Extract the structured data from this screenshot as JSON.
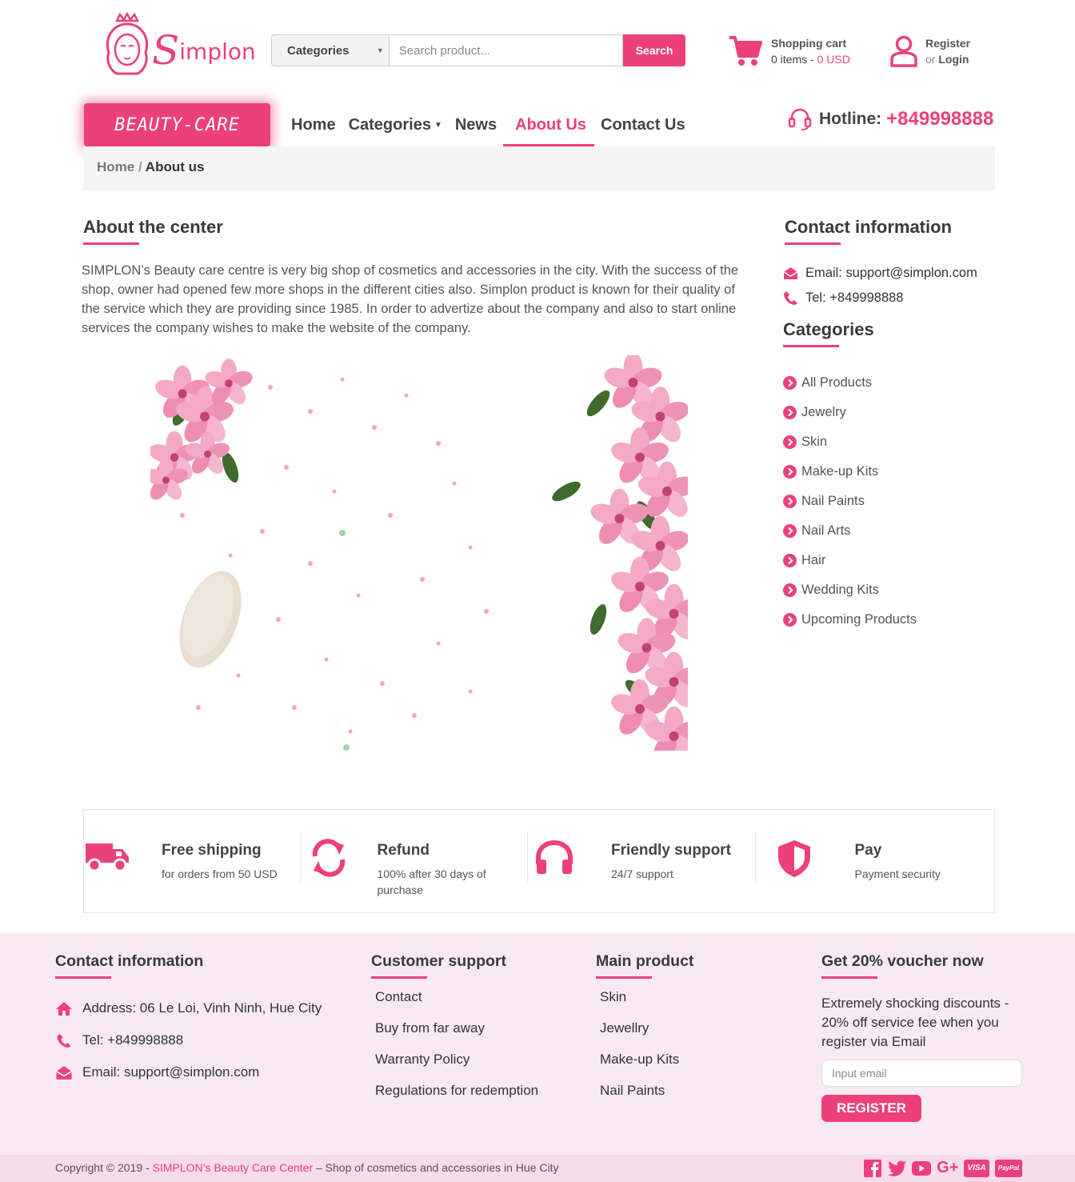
{
  "header": {
    "brand": "Simplon",
    "brand_initial": "S",
    "brand_rest": "implon",
    "search": {
      "category_label": "Categories",
      "placeholder": "Search product...",
      "button": "Search"
    },
    "cart": {
      "title": "Shopping cart",
      "items": "0 items - ",
      "total": "0 USD"
    },
    "account": {
      "register": "Register",
      "or": "or",
      "login": "Login"
    }
  },
  "nav": {
    "badge": "BEAUTY-CARE",
    "items": [
      "Home",
      "Categories",
      "News",
      "About Us",
      "Contact Us"
    ],
    "active": "About Us",
    "hotline_label": "Hotline:",
    "hotline_number": "+849998888"
  },
  "breadcrumb": {
    "home": "Home",
    "separator": "/",
    "current": "About us"
  },
  "about": {
    "title": "About the center",
    "text": "SIMPLON’s Beauty care centre is very big shop of cosmetics and accessories in the city. With the success of the shop, owner had opened few more shops in the different cities also. Simplon product is known for their quality of the service which they are providing since 1985. In order to advertize about the company and also to start online services the company wishes to make the website of the company."
  },
  "sidebar": {
    "contact_title": "Contact information",
    "email": "Email: support@simplon.com",
    "tel": "Tel: +849998888",
    "categories_title": "Categories",
    "categories": [
      "All Products",
      "Jewelry",
      "Skin",
      "Make-up Kits",
      "Nail Paints",
      "Nail Arts",
      "Hair",
      "Wedding Kits",
      "Upcoming Products"
    ]
  },
  "features": [
    {
      "icon": "truck-icon",
      "title": "Free shipping",
      "sub": "for orders from 50 USD"
    },
    {
      "icon": "refund-icon",
      "title": "Refund",
      "sub": "100% after 30 days of purchase"
    },
    {
      "icon": "headphones-icon",
      "title": "Friendly support",
      "sub": "24/7 support"
    },
    {
      "icon": "shield-icon",
      "title": "Pay",
      "sub": "Payment security"
    }
  ],
  "footer": {
    "contact": {
      "title": "Contact information",
      "address": "Address: 06 Le Loi, Vinh Ninh, Hue City",
      "tel": "Tel: +849998888",
      "email": "Email: support@simplon.com"
    },
    "support": {
      "title": "Customer support",
      "links": [
        "Contact",
        "Buy from far away",
        "Warranty Policy",
        "Regulations for redemption"
      ]
    },
    "main_product": {
      "title": "Main product",
      "links": [
        "Skin",
        "Jewellry",
        "Make-up Kits",
        "Nail Paints"
      ]
    },
    "voucher": {
      "title": "Get 20% voucher now",
      "text": "Extremely shocking discounts - 20% off service fee when you register via Email",
      "placeholder": "Input email",
      "button": "REGISTER"
    },
    "copyright_prefix": "Copyright © 2019 - ",
    "copyright_link": "SIMPLON’s Beauty Care Center",
    "copyright_suffix": " – Shop of cosmetics and accessories in Hue City",
    "social": {
      "google": "G+",
      "visa": "VISA",
      "paypal": "PayPal"
    }
  },
  "colors": {
    "accent": "#ec407a",
    "footer_bg": "#f9e9f2",
    "copyright_bg": "#f7dceb"
  }
}
